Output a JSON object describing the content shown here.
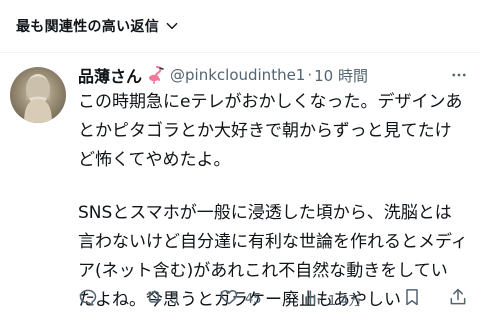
{
  "reply_sort": {
    "label": "最も関連性の高い返信",
    "icon": "chevron-down-icon"
  },
  "tweet": {
    "display_name": "品薄さん",
    "name_emoji": "flamingo-icon",
    "handle": "@pinkcloudinthe1",
    "separator": "·",
    "time": "10 時間",
    "text_lines_1": [
      "この時期急にeテレがおかしくなった。デザインあ",
      "とかピタゴラとか大好きで朝からずっと見てたけ",
      "ど怖くてやめたよ。"
    ],
    "text_lines_2": [
      "SNSとスマホが一般に浸透した頃から、洗脳とは",
      "言わないけど自分達に有利な世論を作れるとメディ",
      "ア(ネット含む)があれこれ不自然な動きをしてい",
      "たよね。今思うとガラケー廃止もあやしい"
    ]
  },
  "actions": {
    "reply_count": "",
    "repost_count": "5",
    "like_count": "45",
    "views_count": "1.4万"
  },
  "colors": {
    "text": "#0f1419",
    "secondary": "#536471",
    "divider": "#eff3f4"
  }
}
